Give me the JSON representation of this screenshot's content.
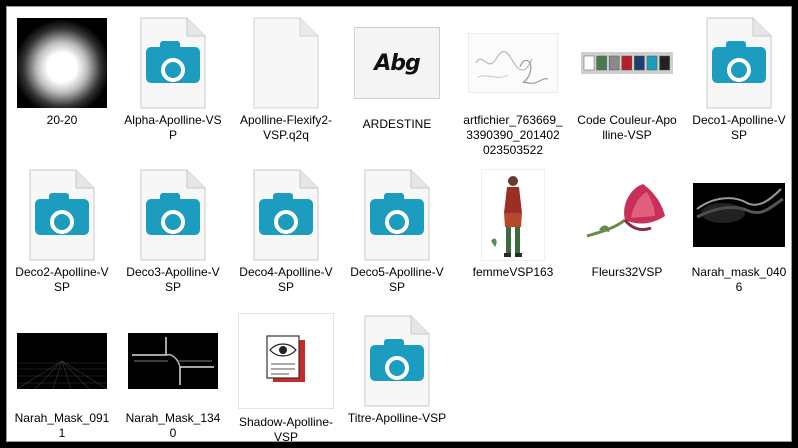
{
  "window": {
    "background": "#ffffff",
    "frame": "#000000"
  },
  "files": [
    {
      "name": "20-20",
      "kind": "gradient-image",
      "icon": "radial-gradient-thumbnail"
    },
    {
      "name": "Alpha-Apolline-VSP",
      "kind": "camera-doc",
      "icon": "camera-icon"
    },
    {
      "name": "Apolline-Flexify2-VSP.q2q",
      "kind": "blank-doc",
      "icon": "blank-file-icon"
    },
    {
      "name": "ARDESTINE",
      "kind": "font",
      "icon": "font-preview-icon",
      "preview_text": "Abg"
    },
    {
      "name": "artfichier_763669_3390390_201402023503522",
      "kind": "image",
      "icon": "handwriting-thumbnail"
    },
    {
      "name": "Code Couleur-Apolline-VSP",
      "kind": "image",
      "icon": "color-swatches-thumbnail"
    },
    {
      "name": "Deco1-Apolline-VSP",
      "kind": "camera-doc",
      "icon": "camera-icon"
    },
    {
      "name": "Deco2-Apolline-VSP",
      "kind": "camera-doc",
      "icon": "camera-icon"
    },
    {
      "name": "Deco3-Apolline-VSP",
      "kind": "camera-doc",
      "icon": "camera-icon"
    },
    {
      "name": "Deco4-Apolline-VSP",
      "kind": "camera-doc",
      "icon": "camera-icon"
    },
    {
      "name": "Deco5-Apolline-VSP",
      "kind": "camera-doc",
      "icon": "camera-icon"
    },
    {
      "name": "femmeVSP163",
      "kind": "image",
      "icon": "woman-thumbnail"
    },
    {
      "name": "Fleurs32VSP",
      "kind": "image",
      "icon": "flower-thumbnail"
    },
    {
      "name": "Narah_mask_0406",
      "kind": "image",
      "icon": "mask-thumbnail"
    },
    {
      "name": "Narah_Mask_0911",
      "kind": "image",
      "icon": "grid-mask-thumbnail"
    },
    {
      "name": "Narah_Mask_1340",
      "kind": "image",
      "icon": "frame-mask-thumbnail"
    },
    {
      "name": "Shadow-Apolline-VSP",
      "kind": "shadow",
      "icon": "eye-document-icon"
    },
    {
      "name": "Titre-Apolline-VSP",
      "kind": "camera-doc",
      "icon": "camera-icon"
    }
  ],
  "swatches": [
    "#ffffff",
    "#4a7a52",
    "#8a8a8a",
    "#b3202c",
    "#1d3f6e",
    "#1c9cbf",
    "#222222"
  ],
  "colors": {
    "camera_blue": "#1c9cbf"
  }
}
